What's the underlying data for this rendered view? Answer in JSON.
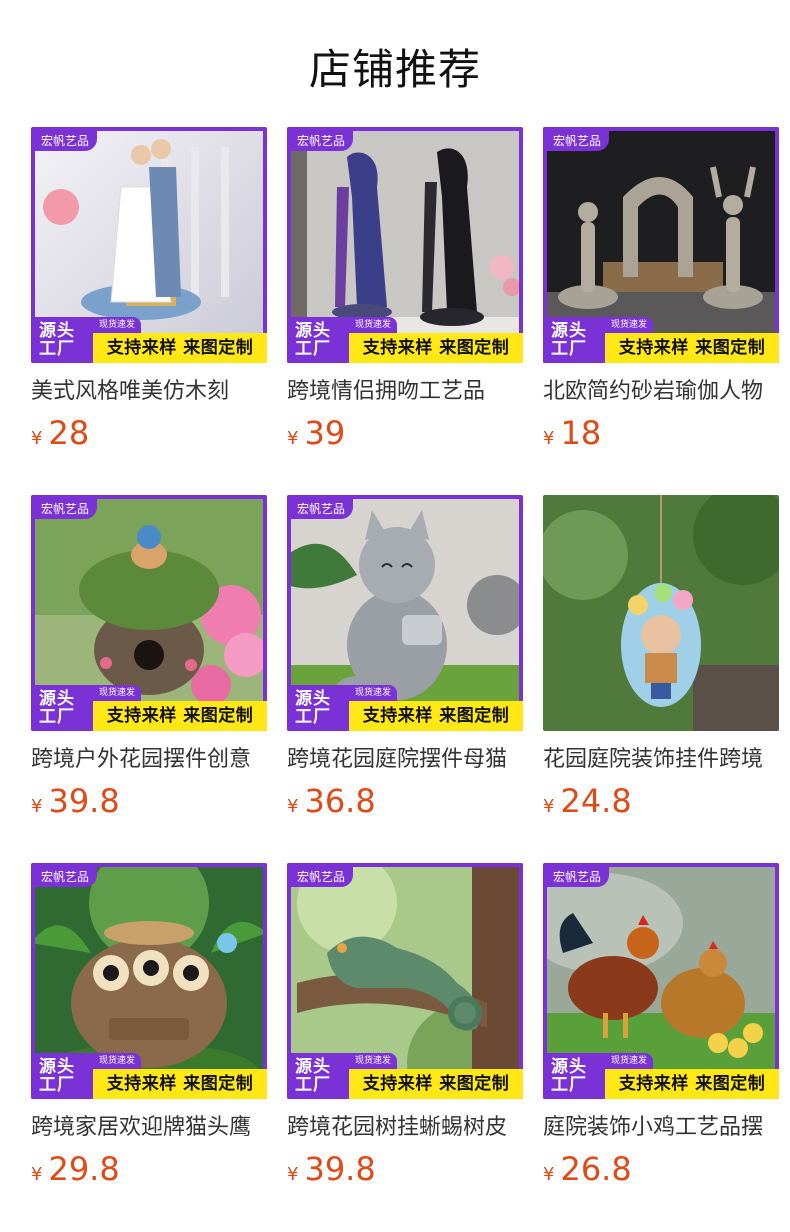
{
  "section_title": "店铺推荐",
  "badges": {
    "brand": "宏帆艺品",
    "factory": "源头工厂",
    "stock": "现货速发",
    "slogan": "支持来样 来图定制"
  },
  "currency": "¥",
  "products": [
    {
      "name": "美式风格唯美仿木刻",
      "price": "28",
      "framed": true,
      "image": "wedding-couple-figurine"
    },
    {
      "name": "跨境情侣拥吻工艺品",
      "price": "39",
      "framed": true,
      "image": "kissing-couple-statues"
    },
    {
      "name": "北欧简约砂岩瑜伽人物",
      "price": "18",
      "framed": true,
      "image": "yoga-figures"
    },
    {
      "name": "跨境户外花园摆件创意",
      "price": "39.8",
      "framed": true,
      "image": "mushroom-birdhouse"
    },
    {
      "name": "跨境花园庭院摆件母猫",
      "price": "36.8",
      "framed": true,
      "image": "cat-watering-can"
    },
    {
      "name": "花园庭院装饰挂件跨境",
      "price": "24.8",
      "framed": false,
      "image": "hanging-flower-doll"
    },
    {
      "name": "跨境家居欢迎牌猫头鹰",
      "price": "29.8",
      "framed": true,
      "image": "owl-welcome-sign"
    },
    {
      "name": "跨境花园树挂蜥蜴树皮",
      "price": "39.8",
      "framed": true,
      "image": "tree-lizard"
    },
    {
      "name": "庭院装饰小鸡工艺品摆",
      "price": "26.8",
      "framed": true,
      "image": "rooster-hen-chicks"
    }
  ]
}
